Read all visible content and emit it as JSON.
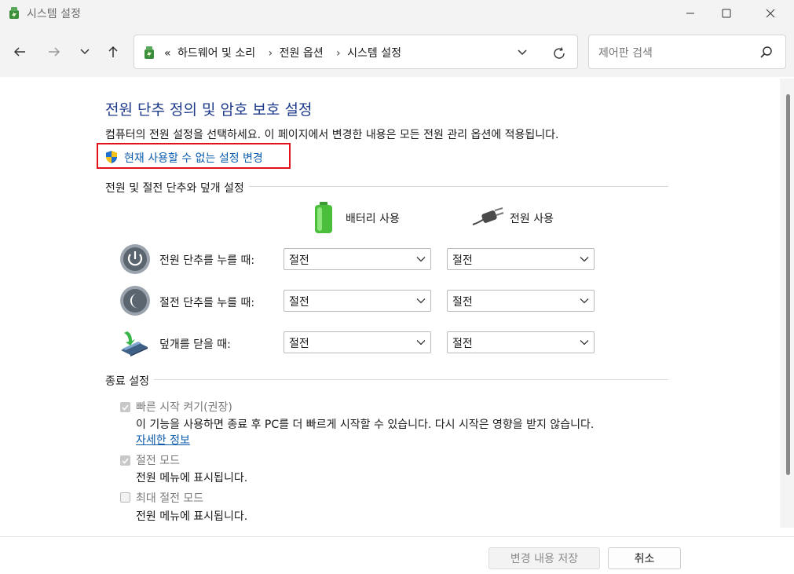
{
  "window": {
    "title": "시스템 설정",
    "app_icon": "power-options-icon"
  },
  "nav": {
    "back_icon": "back-arrow-icon",
    "forward_icon": "forward-arrow-icon",
    "recent_icon": "chevron-down-icon",
    "up_icon": "up-arrow-icon"
  },
  "address": {
    "overflow": "«",
    "crumbs": [
      "하드웨어 및 소리",
      "전원 옵션",
      "시스템 설정"
    ],
    "separator": "›"
  },
  "search": {
    "placeholder": "제어판 검색"
  },
  "main": {
    "title": "전원 단추 정의 및 암호 보호 설정",
    "description": "컴퓨터의 전원 설정을 선택하세요. 이 페이지에서 변경한 내용은 모든 전원 관리 옵션에 적용됩니다.",
    "change_link": "현재 사용할 수 없는 설정 변경",
    "highlight_color": "#e3121a"
  },
  "buttons_section": {
    "heading": "전원 및 절전 단추와 덮개 설정",
    "columns": [
      "배터리 사용",
      "전원 사용"
    ],
    "rows": [
      {
        "label": "전원 단추를 누를 때:",
        "battery": "절전",
        "plugged": "절전",
        "icon": "power-button-icon"
      },
      {
        "label": "절전 단추를 누를 때:",
        "battery": "절전",
        "plugged": "절전",
        "icon": "sleep-button-icon"
      },
      {
        "label": "덮개를 닫을 때:",
        "battery": "절전",
        "plugged": "절전",
        "icon": "laptop-lid-icon"
      }
    ]
  },
  "shutdown_section": {
    "heading": "종료 설정",
    "options": [
      {
        "label": "빠른 시작 켜기(권장)",
        "checked": true,
        "description": "이 기능을 사용하면 종료 후 PC를 더 빠르게 시작할 수 있습니다. 다시 시작은 영향을 받지 않습니다.",
        "link": "자세한 정보"
      },
      {
        "label": "절전 모드",
        "checked": true,
        "description": "전원 메뉴에 표시됩니다."
      },
      {
        "label": "최대 절전 모드",
        "checked": false,
        "description": "전원 메뉴에 표시됩니다."
      }
    ]
  },
  "footer": {
    "save": "변경 내용 저장",
    "cancel": "취소"
  }
}
